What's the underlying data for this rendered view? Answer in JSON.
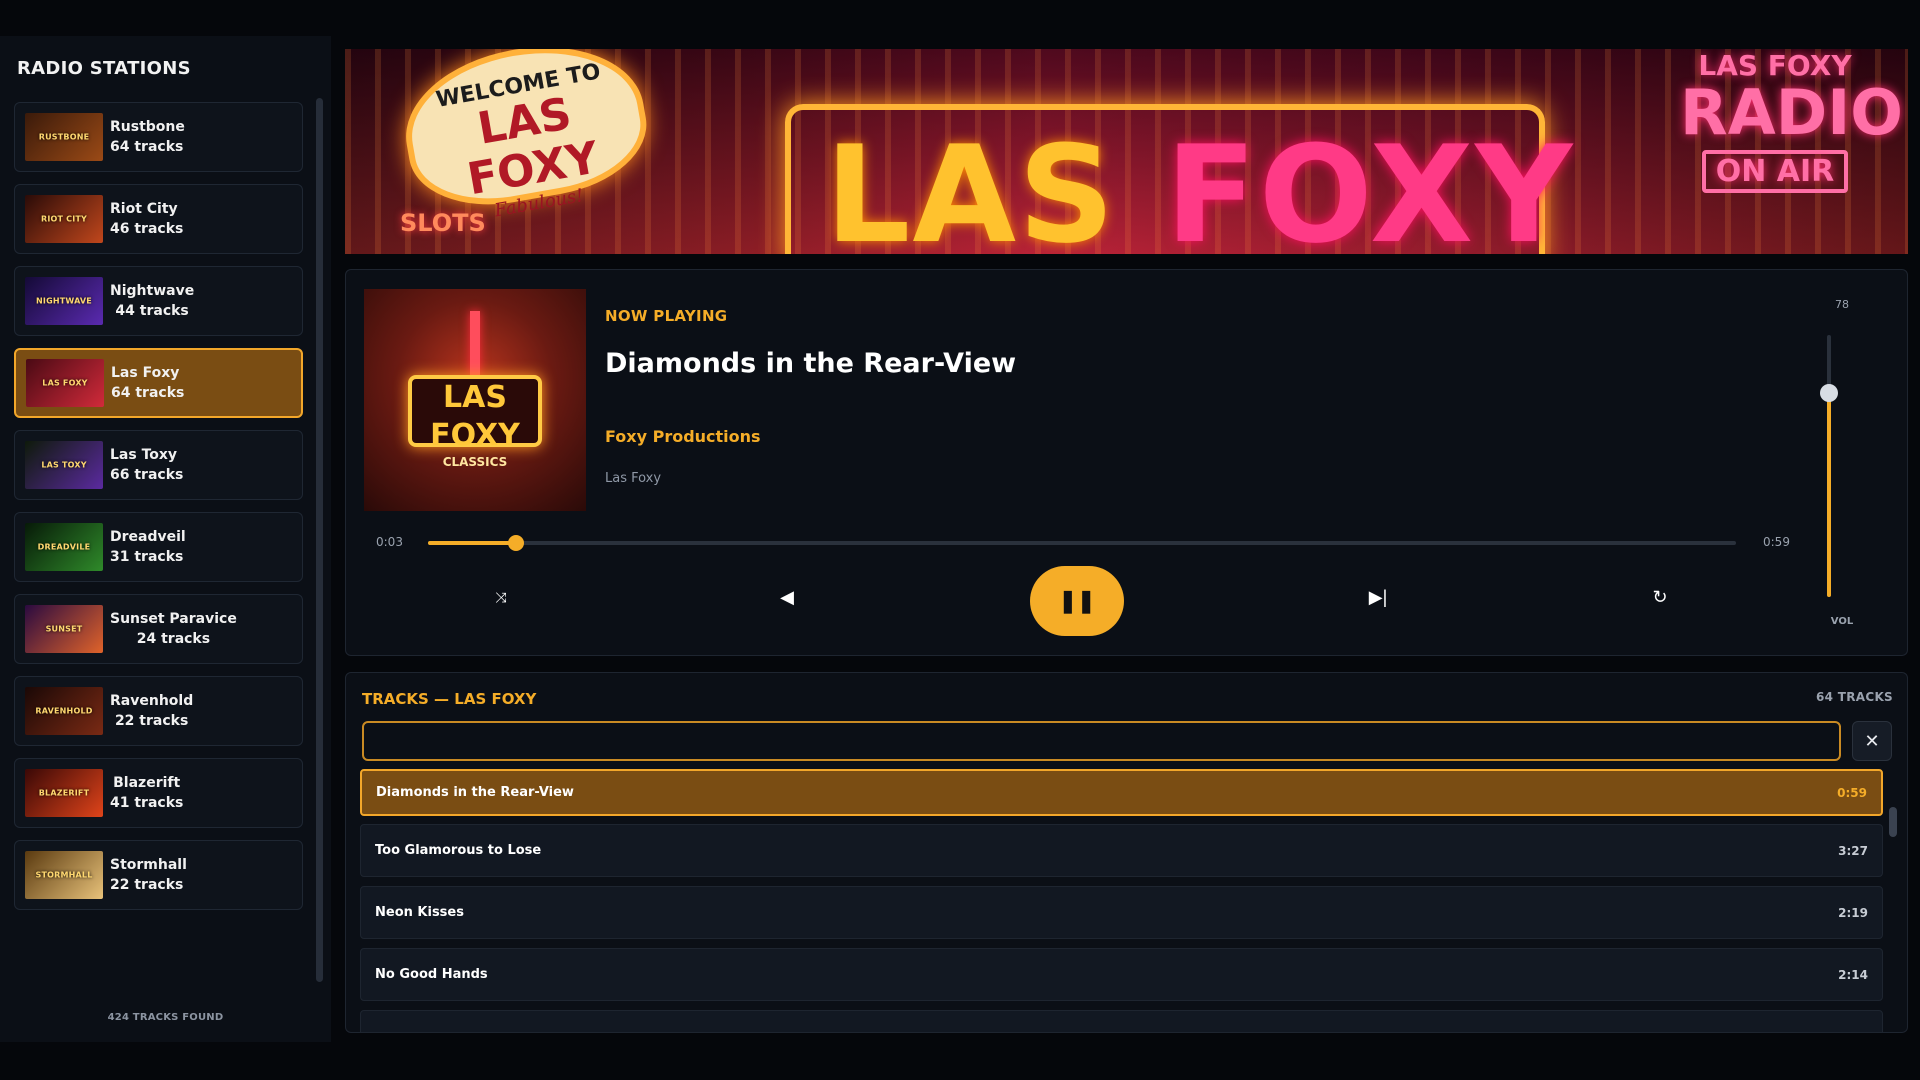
{
  "sidebar": {
    "title": "RADIO STATIONS",
    "footer": "424 TRACKS FOUND",
    "stations": [
      {
        "name": "Rustbone",
        "count": "64 tracks",
        "thumb_label": "RUSTBONE",
        "thumb_colors": [
          "#3a1a0a",
          "#9b4a16"
        ]
      },
      {
        "name": "Riot City",
        "count": "46 tracks",
        "thumb_label": "RIOT CITY",
        "thumb_colors": [
          "#2a0b08",
          "#c1471c"
        ]
      },
      {
        "name": "Nightwave",
        "count": "44 tracks",
        "thumb_label": "NIGHTWAVE",
        "thumb_colors": [
          "#140a36",
          "#5a2ab0"
        ]
      },
      {
        "name": "Las Foxy",
        "count": "64 tracks",
        "thumb_label": "LAS FOXY",
        "thumb_colors": [
          "#4a0a14",
          "#d12a3a"
        ],
        "active": true
      },
      {
        "name": "Las Toxy",
        "count": "66 tracks",
        "thumb_label": "LAS TOXY",
        "thumb_colors": [
          "#0e1a0a",
          "#5b2aa0"
        ]
      },
      {
        "name": "Dreadveil",
        "count": "31 tracks",
        "thumb_label": "DREADVILE",
        "thumb_colors": [
          "#071a08",
          "#2f8a2a"
        ]
      },
      {
        "name": "Sunset Paravice",
        "count": "24 tracks",
        "thumb_label": "SUNSET",
        "thumb_colors": [
          "#2a0a40",
          "#e0632a"
        ]
      },
      {
        "name": "Ravenhold",
        "count": "22 tracks",
        "thumb_label": "RAVENHOLD",
        "thumb_colors": [
          "#1a0806",
          "#7a2a14"
        ]
      },
      {
        "name": "Blazerift",
        "count": "41 tracks",
        "thumb_label": "BLAZERIFT",
        "thumb_colors": [
          "#3a0806",
          "#e0441a"
        ]
      },
      {
        "name": "Stormhall",
        "count": "22 tracks",
        "thumb_label": "STORMHALL",
        "thumb_colors": [
          "#5a3a10",
          "#e8c27a"
        ]
      }
    ]
  },
  "banner": {
    "welcome_top": "WELCOME TO",
    "welcome_main": "LAS FOXY",
    "welcome_sub": "Fabulous!",
    "slots": "SLOTS",
    "main_word1": "LAS",
    "main_word2": "FOXY",
    "radio_top": "LAS FOXY",
    "radio_main": "RADIO",
    "radio_onair": "ON AIR"
  },
  "player": {
    "now_label": "NOW PLAYING",
    "title": "Diamonds in the Rear-View",
    "artist": "Foxy Productions",
    "station": "Las Foxy",
    "art_title": "LAS FOXY",
    "art_sub": "CLASSICS",
    "current_time": "0:03",
    "duration": "0:59",
    "progress_fraction": 0.067,
    "volume": "78",
    "volume_fraction": 0.78,
    "volume_label": "VOL",
    "controls": {
      "shuffle": "⤨",
      "prev": "◀",
      "pause": "❚❚",
      "next": "▶|",
      "repeat": "↻"
    }
  },
  "tracks": {
    "heading": "TRACKS — LAS FOXY",
    "count": "64 TRACKS",
    "search_value": "",
    "clear_label": "✕",
    "items": [
      {
        "name": "Diamonds in the Rear-View",
        "duration": "0:59",
        "active": true
      },
      {
        "name": "Too Glamorous to Lose",
        "duration": "3:27"
      },
      {
        "name": "Neon Kisses",
        "duration": "2:19"
      },
      {
        "name": "No Good Hands",
        "duration": "2:14"
      }
    ]
  },
  "colors": {
    "accent": "#f5ad28",
    "active_bg": "#7a4d13",
    "panel": "#0b0f16",
    "background": "#05070b"
  }
}
